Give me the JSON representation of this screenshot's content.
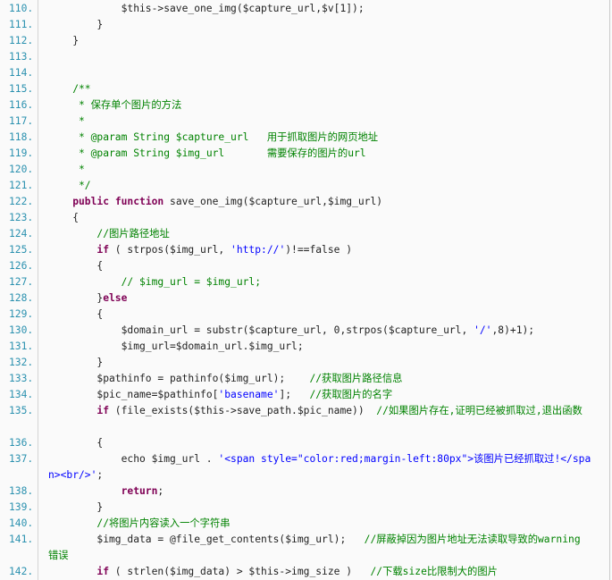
{
  "colors": {
    "line_number": "#2b91af",
    "keyword": "#7f0055",
    "comment": "#008200",
    "string": "#0000ff",
    "text": "#222222",
    "background": "#fafafa"
  },
  "lines": [
    {
      "n": "110.",
      "indent": 3,
      "tokens": [
        {
          "t": "$this->save_one_img($capture_url,$v[1]);",
          "c": ""
        }
      ]
    },
    {
      "n": "111.",
      "indent": 2,
      "tokens": [
        {
          "t": "}",
          "c": ""
        }
      ]
    },
    {
      "n": "112.",
      "indent": 1,
      "tokens": [
        {
          "t": "}",
          "c": ""
        }
      ]
    },
    {
      "n": "113.",
      "indent": 0,
      "tokens": []
    },
    {
      "n": "114.",
      "indent": 0,
      "tokens": []
    },
    {
      "n": "115.",
      "indent": 1,
      "tokens": [
        {
          "t": "/**",
          "c": "cm"
        }
      ]
    },
    {
      "n": "116.",
      "indent": 1,
      "tokens": [
        {
          "t": " * 保存单个图片的方法",
          "c": "cm"
        }
      ]
    },
    {
      "n": "117.",
      "indent": 1,
      "tokens": [
        {
          "t": " *",
          "c": "cm"
        }
      ]
    },
    {
      "n": "118.",
      "indent": 1,
      "tokens": [
        {
          "t": " * @param String $capture_url   用于抓取图片的网页地址",
          "c": "cm"
        }
      ]
    },
    {
      "n": "119.",
      "indent": 1,
      "tokens": [
        {
          "t": " * @param String $img_url       需要保存的图片的url",
          "c": "cm"
        }
      ]
    },
    {
      "n": "120.",
      "indent": 1,
      "tokens": [
        {
          "t": " *",
          "c": "cm"
        }
      ]
    },
    {
      "n": "121.",
      "indent": 1,
      "tokens": [
        {
          "t": " */",
          "c": "cm"
        }
      ]
    },
    {
      "n": "122.",
      "indent": 1,
      "tokens": [
        {
          "t": "public",
          "c": "kw"
        },
        {
          "t": " ",
          "c": ""
        },
        {
          "t": "function",
          "c": "kw"
        },
        {
          "t": " save_one_img($capture_url,$img_url)",
          "c": ""
        }
      ]
    },
    {
      "n": "123.",
      "indent": 1,
      "tokens": [
        {
          "t": "{",
          "c": ""
        }
      ]
    },
    {
      "n": "124.",
      "indent": 2,
      "tokens": [
        {
          "t": "//图片路径地址",
          "c": "cm"
        }
      ]
    },
    {
      "n": "125.",
      "indent": 2,
      "tokens": [
        {
          "t": "if",
          "c": "kw"
        },
        {
          "t": " ( strpos($img_url, ",
          "c": ""
        },
        {
          "t": "'http://'",
          "c": "st"
        },
        {
          "t": ")!==false )",
          "c": ""
        }
      ]
    },
    {
      "n": "126.",
      "indent": 2,
      "tokens": [
        {
          "t": "{",
          "c": ""
        }
      ]
    },
    {
      "n": "127.",
      "indent": 3,
      "tokens": [
        {
          "t": "// $img_url = $img_url;",
          "c": "cm"
        }
      ]
    },
    {
      "n": "128.",
      "indent": 2,
      "tokens": [
        {
          "t": "}",
          "c": ""
        },
        {
          "t": "else",
          "c": "kw"
        }
      ]
    },
    {
      "n": "129.",
      "indent": 2,
      "tokens": [
        {
          "t": "{",
          "c": ""
        }
      ]
    },
    {
      "n": "130.",
      "indent": 3,
      "tokens": [
        {
          "t": "$domain_url = substr($capture_url, 0,strpos($capture_url, ",
          "c": ""
        },
        {
          "t": "'/'",
          "c": "st"
        },
        {
          "t": ",8)+1);",
          "c": ""
        }
      ]
    },
    {
      "n": "131.",
      "indent": 3,
      "tokens": [
        {
          "t": "$img_url=$domain_url.$img_url;",
          "c": ""
        }
      ]
    },
    {
      "n": "132.",
      "indent": 2,
      "tokens": [
        {
          "t": "}",
          "c": ""
        }
      ]
    },
    {
      "n": "133.",
      "indent": 2,
      "tokens": [
        {
          "t": "$pathinfo = pathinfo($img_url);    ",
          "c": ""
        },
        {
          "t": "//获取图片路径信息",
          "c": "cm"
        }
      ]
    },
    {
      "n": "134.",
      "indent": 2,
      "tokens": [
        {
          "t": "$pic_name=$pathinfo[",
          "c": ""
        },
        {
          "t": "'basename'",
          "c": "st"
        },
        {
          "t": "];   ",
          "c": ""
        },
        {
          "t": "//获取图片的名字",
          "c": "cm"
        }
      ]
    },
    {
      "n": "135.",
      "indent": 2,
      "tokens": [
        {
          "t": "if",
          "c": "kw"
        },
        {
          "t": " (file_exists($this->save_path.$pic_name))  ",
          "c": ""
        },
        {
          "t": "//如果图片存在,证明已经被抓取过,退出函数",
          "c": "cm"
        }
      ]
    },
    {
      "n": "",
      "indent": 0,
      "tokens": []
    },
    {
      "n": "136.",
      "indent": 2,
      "tokens": [
        {
          "t": "{",
          "c": ""
        }
      ]
    },
    {
      "n": "137.",
      "indent": 3,
      "tokens": [
        {
          "t": "echo $img_url . ",
          "c": ""
        },
        {
          "t": "'<span style=\"color:red;margin-left:80px\">该图片已经抓取过!</spa",
          "c": "st"
        }
      ]
    },
    {
      "n": "",
      "indent": 0,
      "tokens": [
        {
          "t": "n><br/>'",
          "c": "st"
        },
        {
          "t": ";",
          "c": ""
        }
      ]
    },
    {
      "n": "138.",
      "indent": 3,
      "tokens": [
        {
          "t": "return",
          "c": "kw"
        },
        {
          "t": ";",
          "c": ""
        }
      ]
    },
    {
      "n": "139.",
      "indent": 2,
      "tokens": [
        {
          "t": "}",
          "c": ""
        }
      ]
    },
    {
      "n": "140.",
      "indent": 2,
      "tokens": [
        {
          "t": "//将图片内容读入一个字符串",
          "c": "cm"
        }
      ]
    },
    {
      "n": "141.",
      "indent": 2,
      "tokens": [
        {
          "t": "$img_data = @file_get_contents($img_url);   ",
          "c": ""
        },
        {
          "t": "//屏蔽掉因为图片地址无法读取导致的warning",
          "c": "cm"
        }
      ]
    },
    {
      "n": "",
      "indent": 0,
      "tokens": [
        {
          "t": "错误",
          "c": "cm"
        }
      ]
    },
    {
      "n": "142.",
      "indent": 2,
      "tokens": [
        {
          "t": "if",
          "c": "kw"
        },
        {
          "t": " ( strlen($img_data) > $this->img_size )   ",
          "c": ""
        },
        {
          "t": "//下载size比限制大的图片",
          "c": "cm"
        }
      ]
    }
  ]
}
